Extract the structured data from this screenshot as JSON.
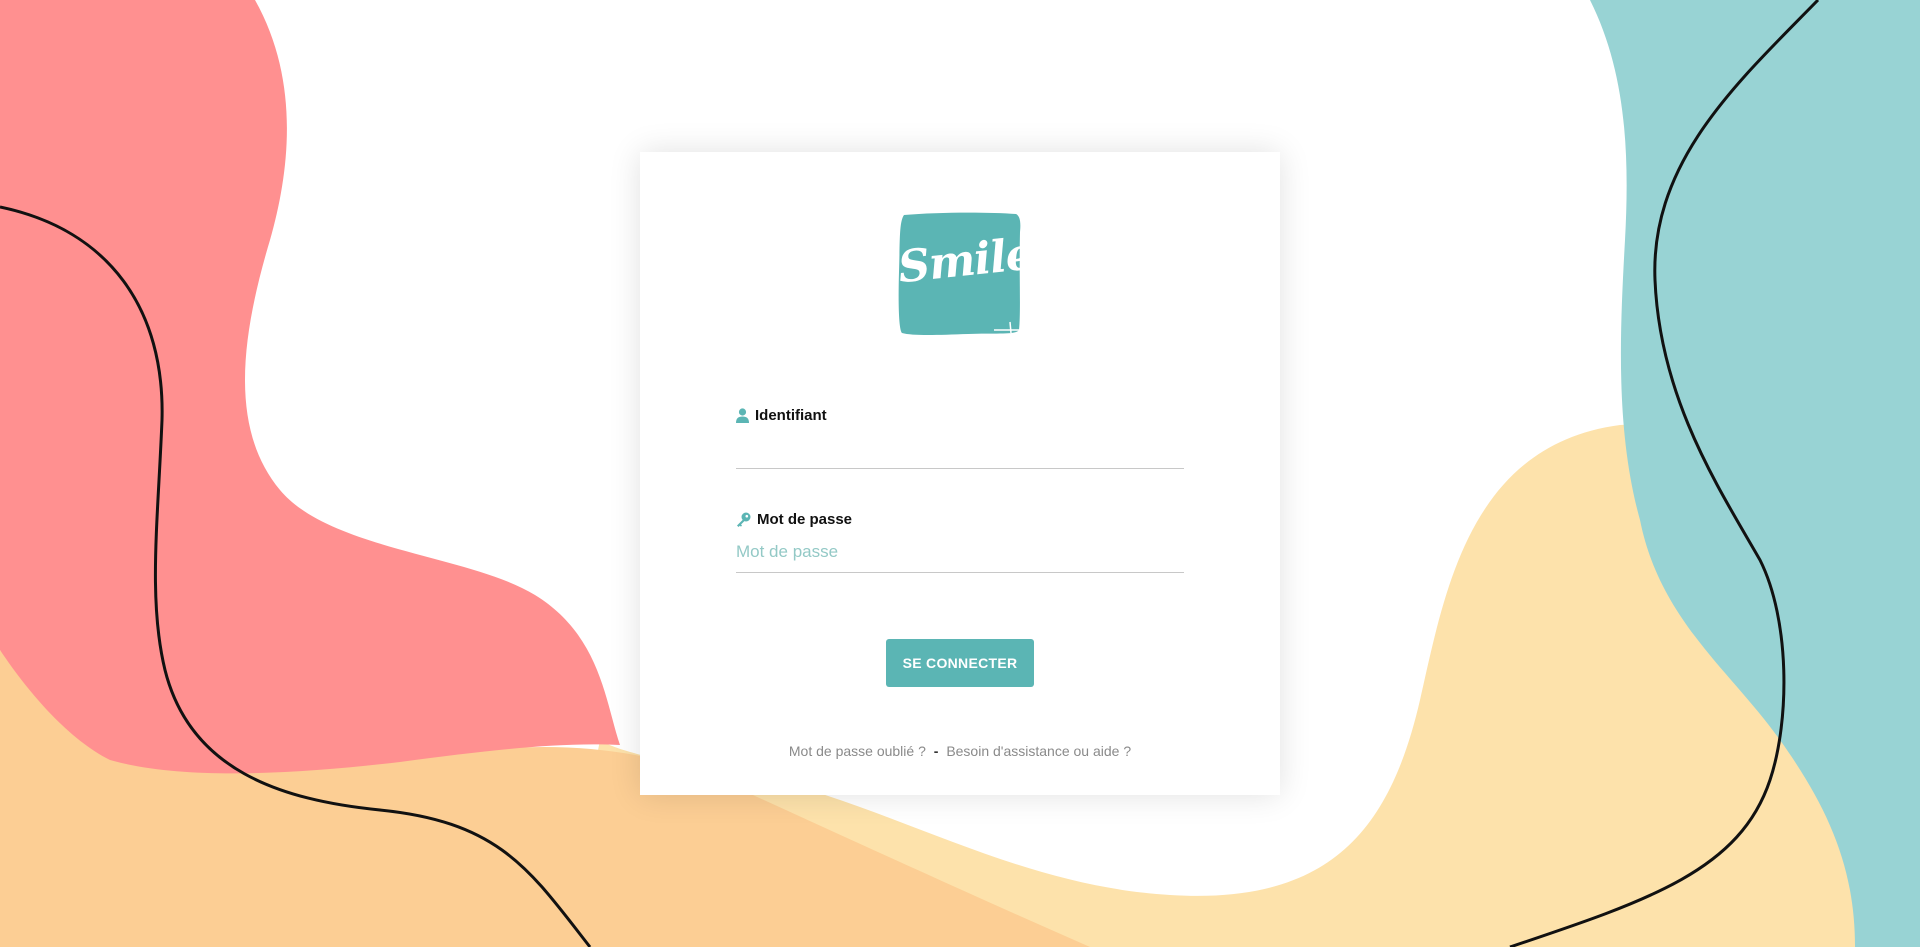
{
  "brand": {
    "logo_text": "Smile",
    "logo_color": "#5bb5b4"
  },
  "form": {
    "identifiant": {
      "label": "Identifiant",
      "value": "",
      "placeholder": "",
      "icon": "user-icon"
    },
    "password": {
      "label": "Mot de passe",
      "value": "",
      "placeholder": "Mot de passe",
      "icon": "key-icon"
    },
    "submit_label": "SE CONNECTER"
  },
  "links": {
    "forgot_password": "Mot de passe oublié ?",
    "separator": "-",
    "help": "Besoin d'assistance ou aide ?"
  },
  "colors": {
    "accent": "#5bb5b4",
    "blob_red": "#ff9090",
    "blob_orange": "#fcce94",
    "blob_yellow": "#fde2ab",
    "blob_teal": "#98d3d4"
  }
}
